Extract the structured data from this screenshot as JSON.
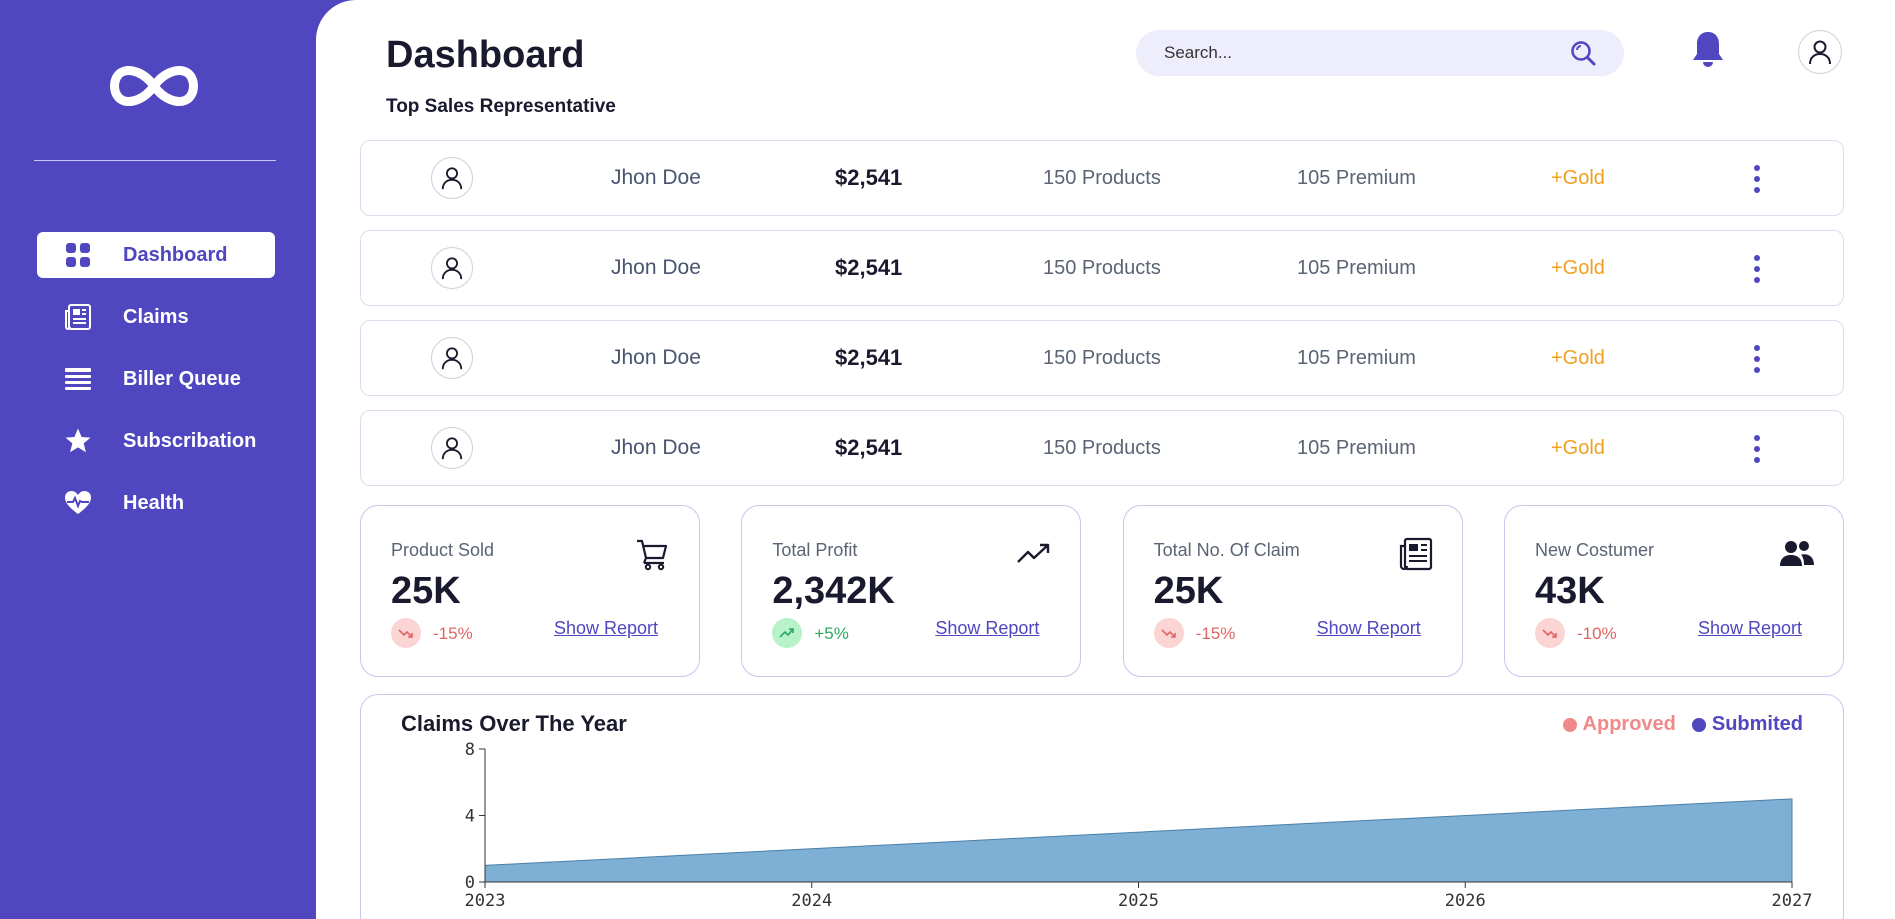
{
  "sidebar": {
    "items": [
      {
        "label": "Dashboard",
        "icon": "grid-icon",
        "active": true
      },
      {
        "label": "Claims",
        "icon": "newspaper-icon",
        "active": false
      },
      {
        "label": "Biller Queue",
        "icon": "list-icon",
        "active": false
      },
      {
        "label": "Subscribation",
        "icon": "star-icon",
        "active": false
      },
      {
        "label": "Health",
        "icon": "heart-pulse-icon",
        "active": false
      }
    ]
  },
  "header": {
    "title": "Dashboard",
    "subtitle": "Top Sales Representative",
    "search_placeholder": "Search..."
  },
  "reps": [
    {
      "name": "Jhon Doe",
      "amount": "$2,541",
      "products": "150 Products",
      "premium": "105 Premium",
      "tier": "+Gold"
    },
    {
      "name": "Jhon Doe",
      "amount": "$2,541",
      "products": "150 Products",
      "premium": "105 Premium",
      "tier": "+Gold"
    },
    {
      "name": "Jhon Doe",
      "amount": "$2,541",
      "products": "150 Products",
      "premium": "105 Premium",
      "tier": "+Gold"
    },
    {
      "name": "Jhon Doe",
      "amount": "$2,541",
      "products": "150 Products",
      "premium": "105 Premium",
      "tier": "+Gold"
    }
  ],
  "stats": [
    {
      "label": "Product Sold",
      "value": "25K",
      "change": "-15%",
      "trend": "down",
      "link": "Show Report",
      "icon": "cart-icon"
    },
    {
      "label": "Total Profit",
      "value": "2,342K",
      "change": "+5%",
      "trend": "up",
      "link": "Show Report",
      "icon": "trending-up-icon"
    },
    {
      "label": "Total No. Of Claim",
      "value": "25K",
      "change": "-15%",
      "trend": "down",
      "link": "Show Report",
      "icon": "newspaper-icon"
    },
    {
      "label": "New Costumer",
      "value": "43K",
      "change": "-10%",
      "trend": "down",
      "link": "Show Report",
      "icon": "users-icon"
    }
  ],
  "colors": {
    "brand": "#4f46c0",
    "gold": "#f0a020",
    "approved": "#f08a8a",
    "submited": "#4f46c0",
    "area_fill": "#7eb0d6"
  },
  "chart_data": {
    "type": "area",
    "title": "Claims Over The Year",
    "legend": [
      {
        "name": "Approved",
        "color": "#f08a8a"
      },
      {
        "name": "Submited",
        "color": "#4f46c0"
      }
    ],
    "legend_position": "top-right",
    "x": [
      2023,
      2027
    ],
    "y": [
      1,
      5
    ],
    "xticks": [
      "2023",
      "2024",
      "2025",
      "2026",
      "2027"
    ],
    "yticks": [
      "0",
      "4",
      "8"
    ],
    "xlim": [
      2023,
      2027
    ],
    "ylim": [
      0,
      8
    ],
    "grid": false
  }
}
